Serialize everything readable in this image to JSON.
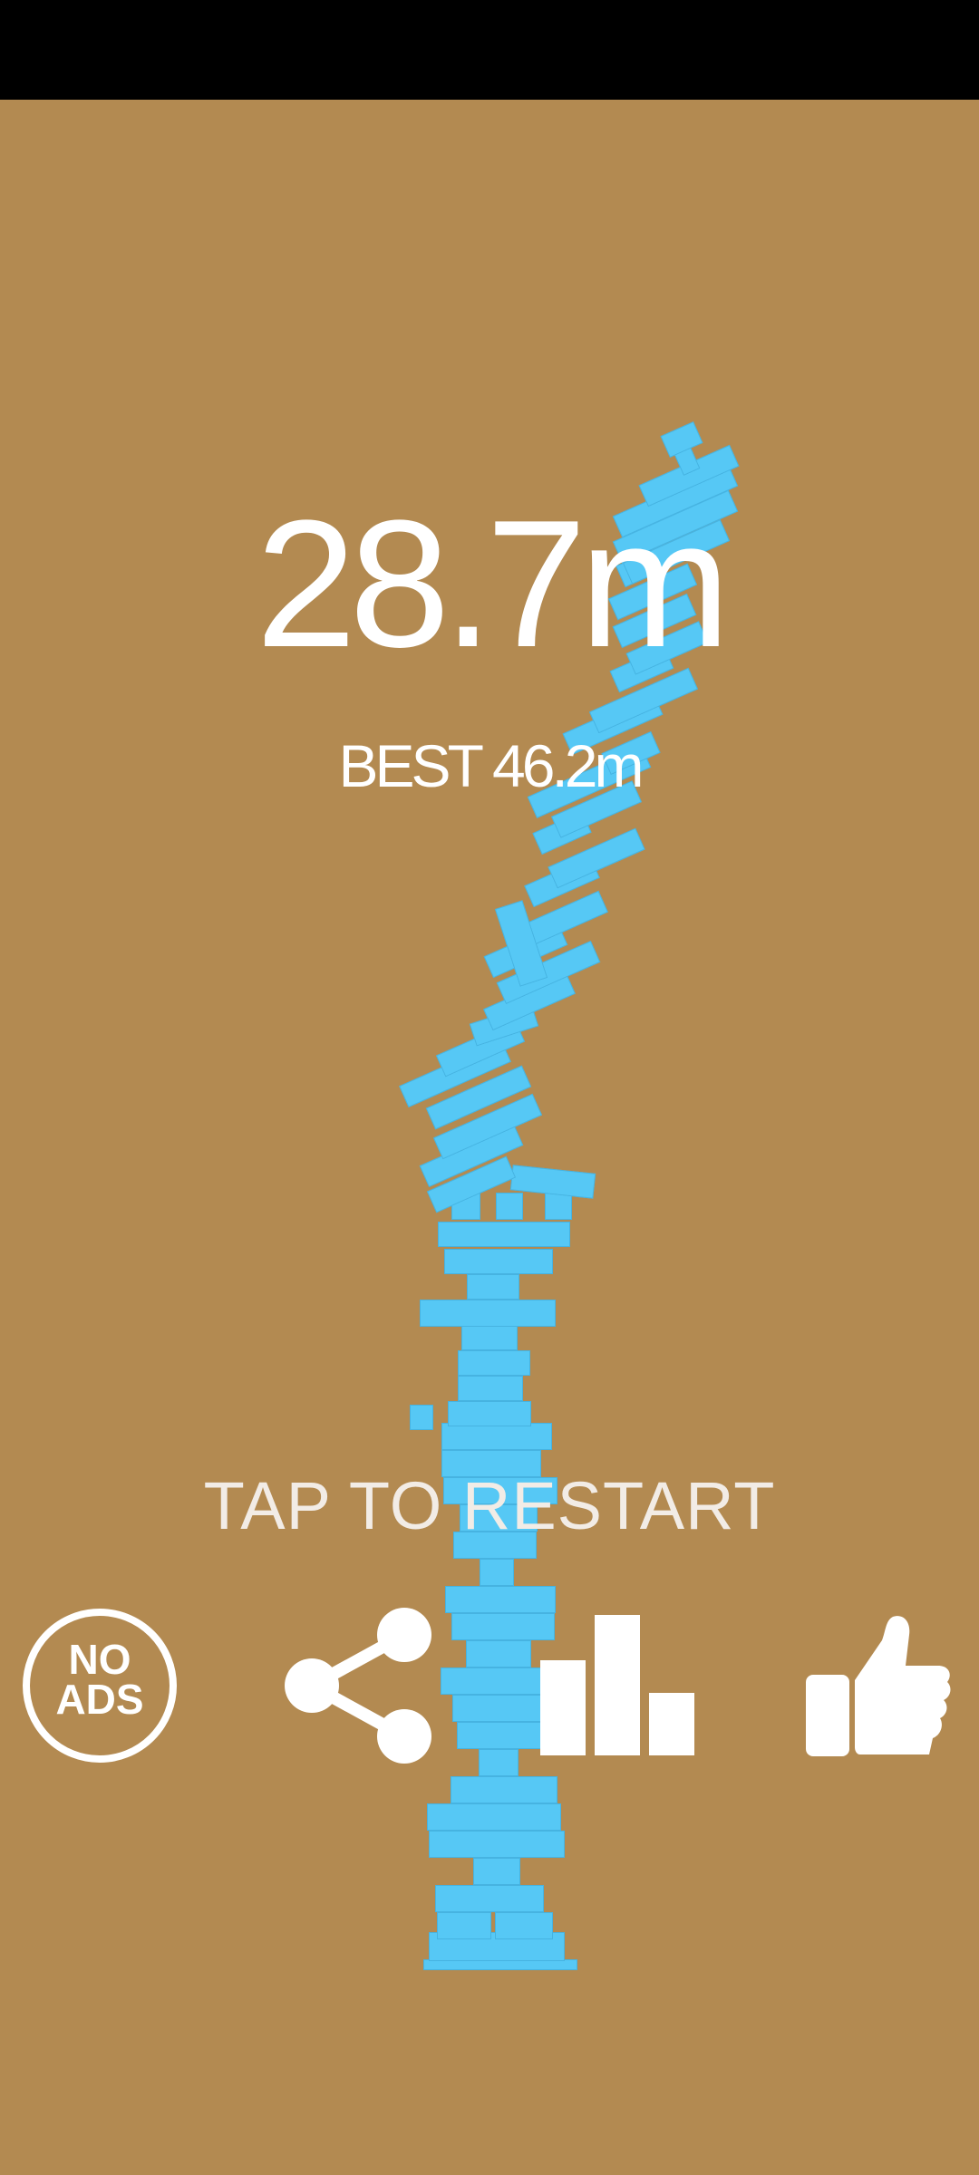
{
  "status_bar": {
    "color": "#000000"
  },
  "game": {
    "background": "#b38a51",
    "block_color": "#56c8f5",
    "score": "28.7m",
    "best": "BEST 46.2m",
    "restart_prompt": "TAP TO RESTART"
  },
  "buttons": {
    "no_ads": {
      "line1": "NO",
      "line2": "ADS",
      "icon": "no-ads-icon"
    },
    "share": {
      "icon": "share-icon"
    },
    "leaderboard": {
      "icon": "bar-chart-icon"
    },
    "like": {
      "icon": "thumbs-up-icon"
    }
  }
}
